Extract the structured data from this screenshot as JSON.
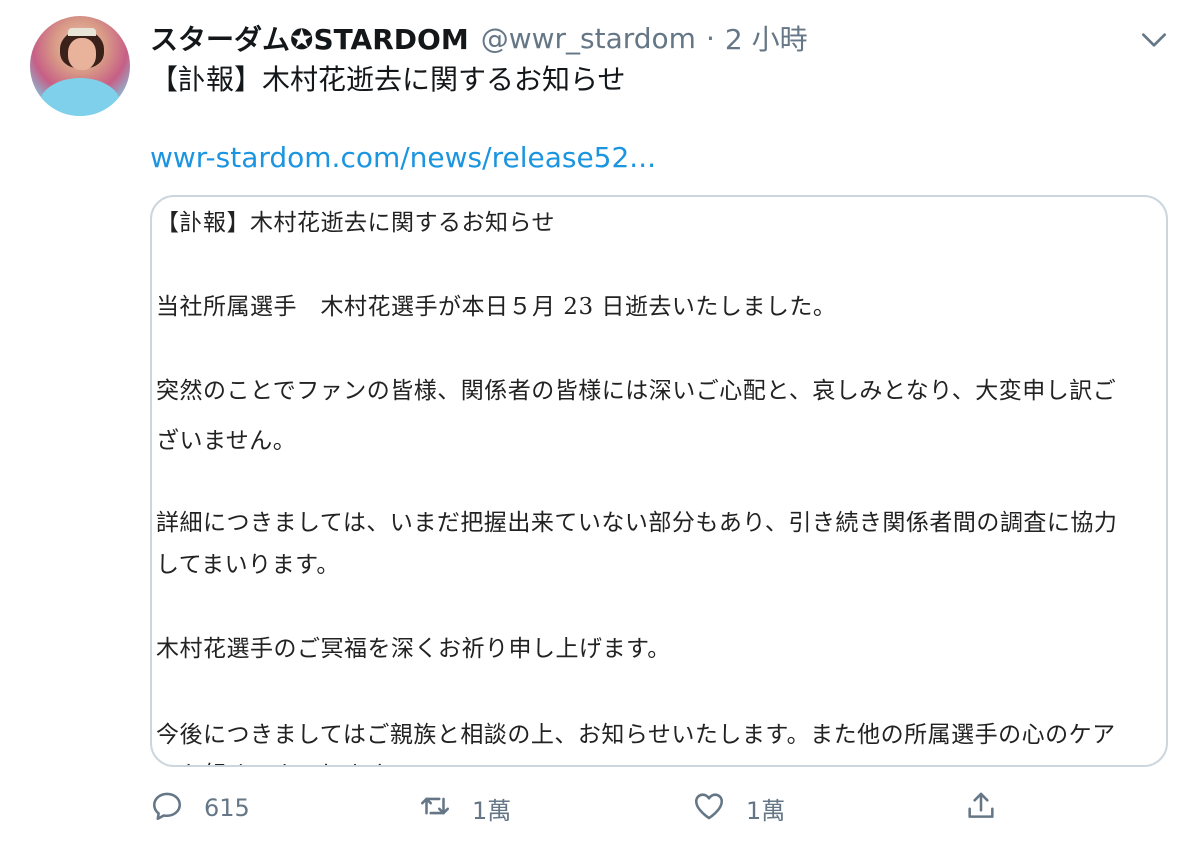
{
  "author": {
    "display_name": "スターダム✪STARDOM",
    "handle": "@wwr_stardom",
    "separator": "·",
    "time": "2 小時"
  },
  "tweet": {
    "text": "【訃報】木村花逝去に関するお知らせ",
    "link": "wwr-stardom.com/news/release52..."
  },
  "image_text": {
    "lines": [
      "【訃報】木村花逝去に関するお知らせ",
      "当社所属選手　木村花選手が本日５月 23 日逝去いたしました。",
      "突然のことでファンの皆様、関係者の皆様には深いご心配と、哀しみとなり、大変申し訳ご",
      "ざいません。",
      "詳細につきましては、いまだ把握出来ていない部分もあり、引き続き関係者間の調査に協力",
      "してまいります。",
      "木村花選手のご冥福を深くお祈り申し上げます。",
      "今後につきましてはご親族と相談の上、お知らせいたします。また他の所属選手の心のケア",
      "にも努めてまいります。"
    ]
  },
  "actions": {
    "reply_count": "615",
    "retweet_count": "1萬",
    "like_count": "1萬"
  },
  "icons": {
    "avatar": "profile-photo",
    "menu": "chevron-down-icon",
    "reply": "reply-icon",
    "retweet": "retweet-icon",
    "like": "heart-icon",
    "share": "share-icon"
  },
  "colors": {
    "text": "#14171a",
    "muted": "#657786",
    "link": "#1b95e0",
    "border": "#ccd6dd"
  }
}
